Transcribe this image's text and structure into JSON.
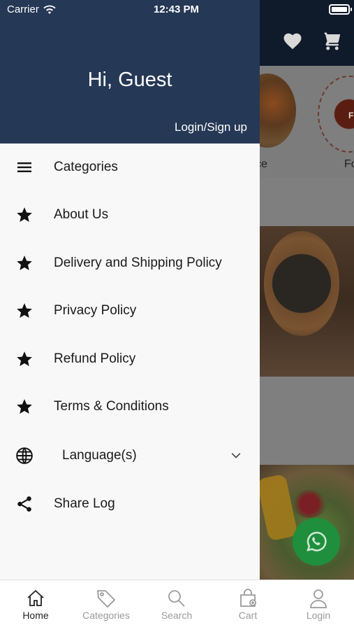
{
  "status_bar": {
    "carrier": "Carrier",
    "time": "12:43 PM"
  },
  "drawer": {
    "greeting": "Hi, Guest",
    "login_link": "Login/Sign up",
    "items": [
      {
        "label": "Categories",
        "icon": "menu-icon"
      },
      {
        "label": "About Us",
        "icon": "star-icon"
      },
      {
        "label": "Delivery and Shipping Policy",
        "icon": "star-icon"
      },
      {
        "label": "Privacy Policy",
        "icon": "star-icon"
      },
      {
        "label": "Refund Policy",
        "icon": "star-icon"
      },
      {
        "label": "Terms & Conditions",
        "icon": "star-icon"
      },
      {
        "label": "Language(s)",
        "icon": "globe-icon"
      },
      {
        "label": "Share Log",
        "icon": "share-icon"
      }
    ]
  },
  "background": {
    "category_labels": [
      "ce",
      "Fo"
    ],
    "circle_text": "FO"
  },
  "tabbar": {
    "tabs": [
      {
        "label": "Home",
        "icon": "home-icon",
        "active": true
      },
      {
        "label": "Categories",
        "icon": "tag-icon",
        "active": false
      },
      {
        "label": "Search",
        "icon": "search-icon",
        "active": false
      },
      {
        "label": "Cart",
        "icon": "bag-icon",
        "active": false
      },
      {
        "label": "Login",
        "icon": "user-icon",
        "active": false
      }
    ]
  },
  "colors": {
    "drawer_header": "#253855",
    "app_header": "#0f1a2b",
    "overlay": "#7f7f7f",
    "whatsapp": "#1f8f3d"
  }
}
